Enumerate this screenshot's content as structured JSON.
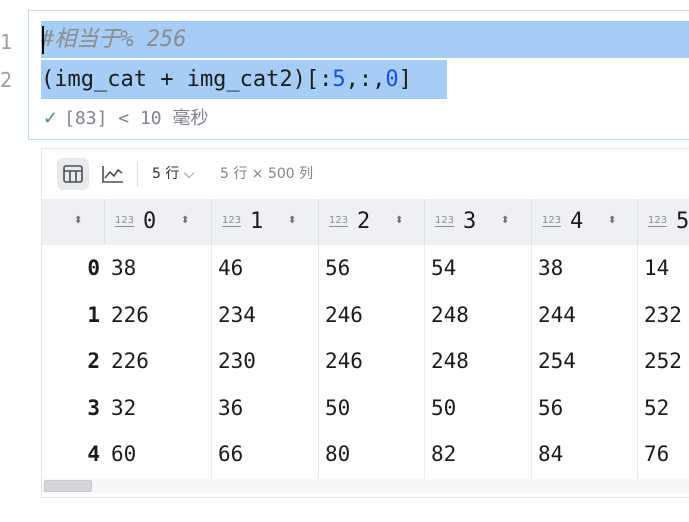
{
  "editor": {
    "line_numbers": [
      "1",
      "2"
    ],
    "comment": "#相当于% 256",
    "code": {
      "open": "(img_cat + img_cat2)[:",
      "n1": "5",
      "mid": ",:,",
      "n2": "0",
      "close": "]"
    },
    "status": {
      "exec_count": "[83]",
      "duration": "< 10 毫秒"
    }
  },
  "output": {
    "toolbar": {
      "table_view": "table-icon",
      "chart_view": "chart-icon",
      "rows_selector": "5 行",
      "shape": "5 行 × 500 列"
    },
    "columns": [
      {
        "type": "123",
        "name": "0"
      },
      {
        "type": "123",
        "name": "1"
      },
      {
        "type": "123",
        "name": "2"
      },
      {
        "type": "123",
        "name": "3"
      },
      {
        "type": "123",
        "name": "4"
      },
      {
        "type": "123",
        "name": "5"
      }
    ],
    "row_index": [
      "0",
      "1",
      "2",
      "3",
      "4"
    ],
    "rows": [
      [
        "38",
        "46",
        "56",
        "54",
        "38",
        "14"
      ],
      [
        "226",
        "234",
        "246",
        "248",
        "244",
        "232"
      ],
      [
        "226",
        "230",
        "246",
        "248",
        "254",
        "252"
      ],
      [
        "32",
        "36",
        "50",
        "50",
        "56",
        "52"
      ],
      [
        "60",
        "66",
        "80",
        "82",
        "84",
        "76"
      ]
    ],
    "colors": {
      "selection": "#a6cdf6",
      "number": "#1750eb",
      "success": "#3a9a53"
    }
  }
}
